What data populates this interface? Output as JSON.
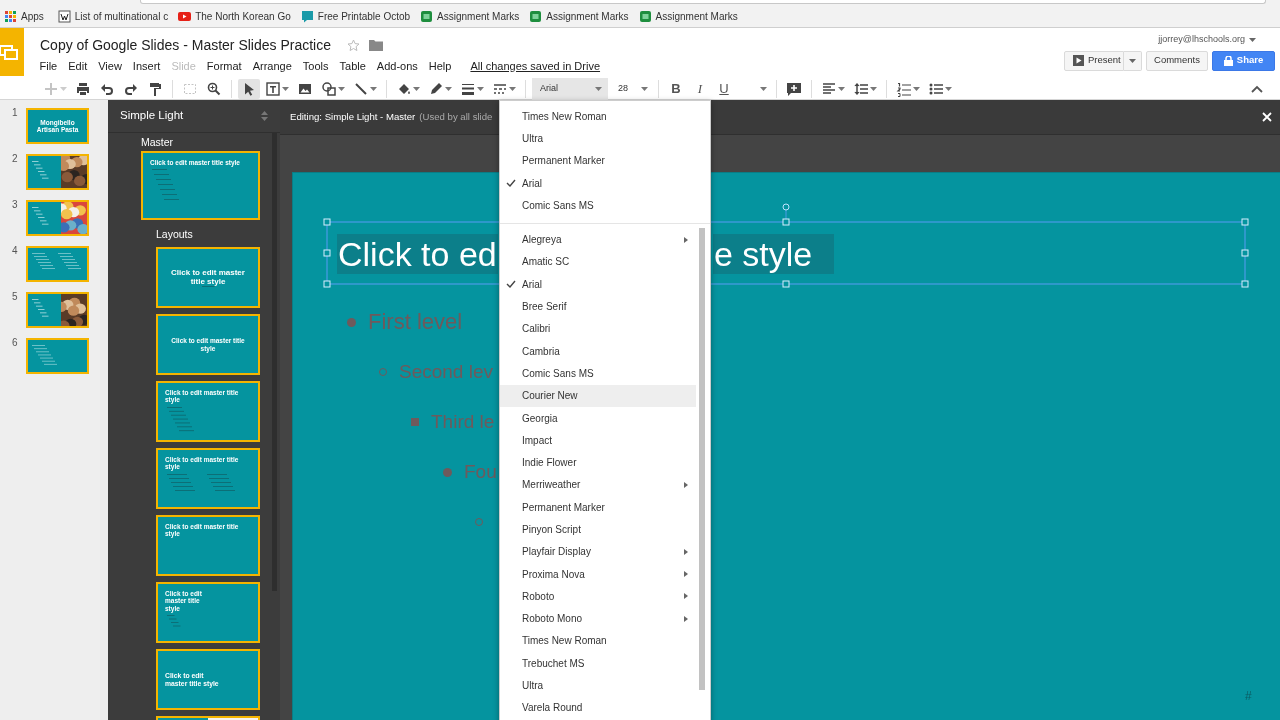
{
  "bookmarks": [
    {
      "label": "Apps"
    },
    {
      "label": "List of multinational c"
    },
    {
      "label": "The North Korean Go"
    },
    {
      "label": "Free Printable Octob"
    },
    {
      "label": "Assignment Marks"
    },
    {
      "label": "Assignment Marks"
    },
    {
      "label": "Assignment Marks"
    }
  ],
  "document": {
    "title": "Copy of Google Slides - Master Slides Practice",
    "starred": false
  },
  "menu": [
    {
      "label": "File",
      "disabled": false
    },
    {
      "label": "Edit",
      "disabled": false
    },
    {
      "label": "View",
      "disabled": false
    },
    {
      "label": "Insert",
      "disabled": false
    },
    {
      "label": "Slide",
      "disabled": true
    },
    {
      "label": "Format",
      "disabled": false
    },
    {
      "label": "Arrange",
      "disabled": false
    },
    {
      "label": "Tools",
      "disabled": false
    },
    {
      "label": "Table",
      "disabled": false
    },
    {
      "label": "Add-ons",
      "disabled": false
    },
    {
      "label": "Help",
      "disabled": false
    }
  ],
  "save_status": "All changes saved in Drive",
  "account": "jjorrey@lhschools.org",
  "buttons": {
    "present": "Present",
    "comments": "Comments",
    "share": "Share"
  },
  "toolbar": {
    "tools": [
      {
        "disabled": true,
        "selected": false
      },
      {
        "disabled": false,
        "selected": false
      },
      {
        "disabled": false,
        "selected": false
      },
      {
        "disabled": false,
        "selected": false
      },
      {
        "disabled": false,
        "selected": false
      },
      {
        "disabled": true,
        "selected": false
      },
      {
        "disabled": false,
        "selected": false
      },
      {
        "disabled": false,
        "selected": true
      },
      {
        "disabled": false,
        "selected": false
      },
      {
        "disabled": false,
        "selected": false
      },
      {
        "disabled": false,
        "selected": false
      },
      {
        "disabled": false,
        "selected": false
      },
      {
        "disabled": false,
        "selected": false
      },
      {
        "disabled": false,
        "selected": false
      },
      {
        "disabled": false,
        "selected": false
      },
      {
        "disabled": false,
        "selected": false
      }
    ],
    "font": "Arial",
    "font_size": "28",
    "format": [
      {
        "label": "B"
      },
      {
        "label": "I"
      },
      {
        "label": "U"
      }
    ]
  },
  "filmstrip": [
    {
      "number": "1",
      "kind": "title",
      "title": "Mongibello Artisan Pasta"
    },
    {
      "number": "2",
      "kind": "picture"
    },
    {
      "number": "3",
      "kind": "picture"
    },
    {
      "number": "4",
      "kind": "columns"
    },
    {
      "number": "5",
      "kind": "picture"
    },
    {
      "number": "6",
      "kind": "text"
    }
  ],
  "master_panel": {
    "theme": "Simple Light",
    "master_label": "Master",
    "master": {
      "kind": "content",
      "title": "Click to edit master title style"
    },
    "layouts_label": "Layouts",
    "layouts": [
      {
        "kind": "title",
        "title": "Click to edit master title style"
      },
      {
        "kind": "section",
        "title": "Click to edit master title style"
      },
      {
        "kind": "content",
        "title": "Click to edit master title style"
      },
      {
        "kind": "columns",
        "title": "Click to edit master title style"
      },
      {
        "kind": "title_only",
        "title": "Click to edit master title style"
      },
      {
        "kind": "caption",
        "title": "Click to edit master title style"
      },
      {
        "kind": "main_point",
        "title": "Click to edit master title style"
      },
      {
        "kind": "split"
      }
    ]
  },
  "editor": {
    "heading": "Editing: Simple Light - Master",
    "note": "(Used by all slide",
    "slide": {
      "title_selected": true,
      "title_left": "Click to ed",
      "title_right": "e style",
      "bullets": [
        {
          "kind": "text",
          "text": "First level",
          "children": [
            {
              "kind": "text",
              "text": "Second lev",
              "children": [
                {
                  "kind": "text",
                  "text": "Third le",
                  "children": [
                    {
                      "kind": "text",
                      "text": "Fou",
                      "children": [
                        {
                          "kind": "marker"
                        }
                      ]
                    }
                  ]
                }
              ]
            }
          ]
        }
      ],
      "slide_number": "#"
    }
  },
  "font_menu": {
    "recent": [
      {
        "label": "Times New Roman",
        "checked": false,
        "submenu": false,
        "highlighted": false
      },
      {
        "label": "Ultra",
        "checked": false,
        "submenu": false,
        "highlighted": false
      },
      {
        "label": "Permanent Marker",
        "checked": false,
        "submenu": false,
        "highlighted": false
      },
      {
        "label": "Arial",
        "checked": true,
        "submenu": false,
        "highlighted": false
      },
      {
        "label": "Comic Sans MS",
        "checked": false,
        "submenu": false,
        "highlighted": false
      }
    ],
    "fonts": [
      {
        "label": "Alegreya",
        "checked": false,
        "submenu": true,
        "highlighted": false
      },
      {
        "label": "Amatic SC",
        "checked": false,
        "submenu": false,
        "highlighted": false
      },
      {
        "label": "Arial",
        "checked": true,
        "submenu": false,
        "highlighted": false
      },
      {
        "label": "Bree Serif",
        "checked": false,
        "submenu": false,
        "highlighted": false
      },
      {
        "label": "Calibri",
        "checked": false,
        "submenu": false,
        "highlighted": false
      },
      {
        "label": "Cambria",
        "checked": false,
        "submenu": false,
        "highlighted": false
      },
      {
        "label": "Comic Sans MS",
        "checked": false,
        "submenu": false,
        "highlighted": false
      },
      {
        "label": "Courier New",
        "checked": false,
        "submenu": false,
        "highlighted": true
      },
      {
        "label": "Georgia",
        "checked": false,
        "submenu": false,
        "highlighted": false
      },
      {
        "label": "Impact",
        "checked": false,
        "submenu": false,
        "highlighted": false
      },
      {
        "label": "Indie Flower",
        "checked": false,
        "submenu": false,
        "highlighted": false
      },
      {
        "label": "Merriweather",
        "checked": false,
        "submenu": true,
        "highlighted": false
      },
      {
        "label": "Permanent Marker",
        "checked": false,
        "submenu": false,
        "highlighted": false
      },
      {
        "label": "Pinyon Script",
        "checked": false,
        "submenu": false,
        "highlighted": false
      },
      {
        "label": "Playfair Display",
        "checked": false,
        "submenu": true,
        "highlighted": false
      },
      {
        "label": "Proxima Nova",
        "checked": false,
        "submenu": true,
        "highlighted": false
      },
      {
        "label": "Roboto",
        "checked": false,
        "submenu": true,
        "highlighted": false
      },
      {
        "label": "Roboto Mono",
        "checked": false,
        "submenu": true,
        "highlighted": false
      },
      {
        "label": "Times New Roman",
        "checked": false,
        "submenu": false,
        "highlighted": false
      },
      {
        "label": "Trebuchet MS",
        "checked": false,
        "submenu": false,
        "highlighted": false
      },
      {
        "label": "Ultra",
        "checked": false,
        "submenu": false,
        "highlighted": false
      },
      {
        "label": "Varela Round",
        "checked": false,
        "submenu": false,
        "highlighted": false
      }
    ]
  }
}
